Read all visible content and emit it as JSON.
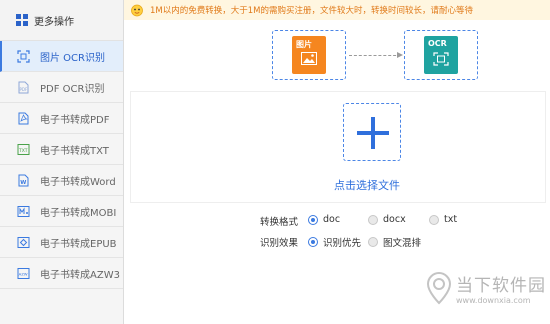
{
  "sidebar": {
    "header": "更多操作",
    "items": [
      {
        "label": "图片 OCR识别",
        "active": true
      },
      {
        "label": "PDF OCR识别",
        "active": false
      },
      {
        "label": "电子书转成PDF",
        "active": false
      },
      {
        "label": "电子书转成TXT",
        "active": false
      },
      {
        "label": "电子书转成Word",
        "active": false
      },
      {
        "label": "电子书转成MOBI",
        "active": false
      },
      {
        "label": "电子书转成EPUB",
        "active": false
      },
      {
        "label": "电子书转成AZW3",
        "active": false
      }
    ]
  },
  "notice": {
    "text": "1M以内的免费转换，大于1M的需购买注册，文件较大时，转换时间较长，请耐心等待"
  },
  "illustration": {
    "source_label": "图片",
    "target_label": "OCR",
    "source_color": "#f5861f",
    "target_color": "#1fa3a0"
  },
  "upload": {
    "label": "点击选择文件"
  },
  "options": {
    "format": {
      "title": "转换格式",
      "choices": [
        "doc",
        "docx",
        "txt"
      ],
      "selected": "doc"
    },
    "effect": {
      "title": "识别效果",
      "choices": [
        "识别优先",
        "图文混排"
      ],
      "selected": "识别优先"
    }
  },
  "watermark": {
    "name": "当下软件园",
    "url": "www.downxia.com"
  },
  "colors": {
    "accent": "#2f6fdc",
    "notice_text": "#e07a1a",
    "notice_bg": "#fff6e0"
  }
}
